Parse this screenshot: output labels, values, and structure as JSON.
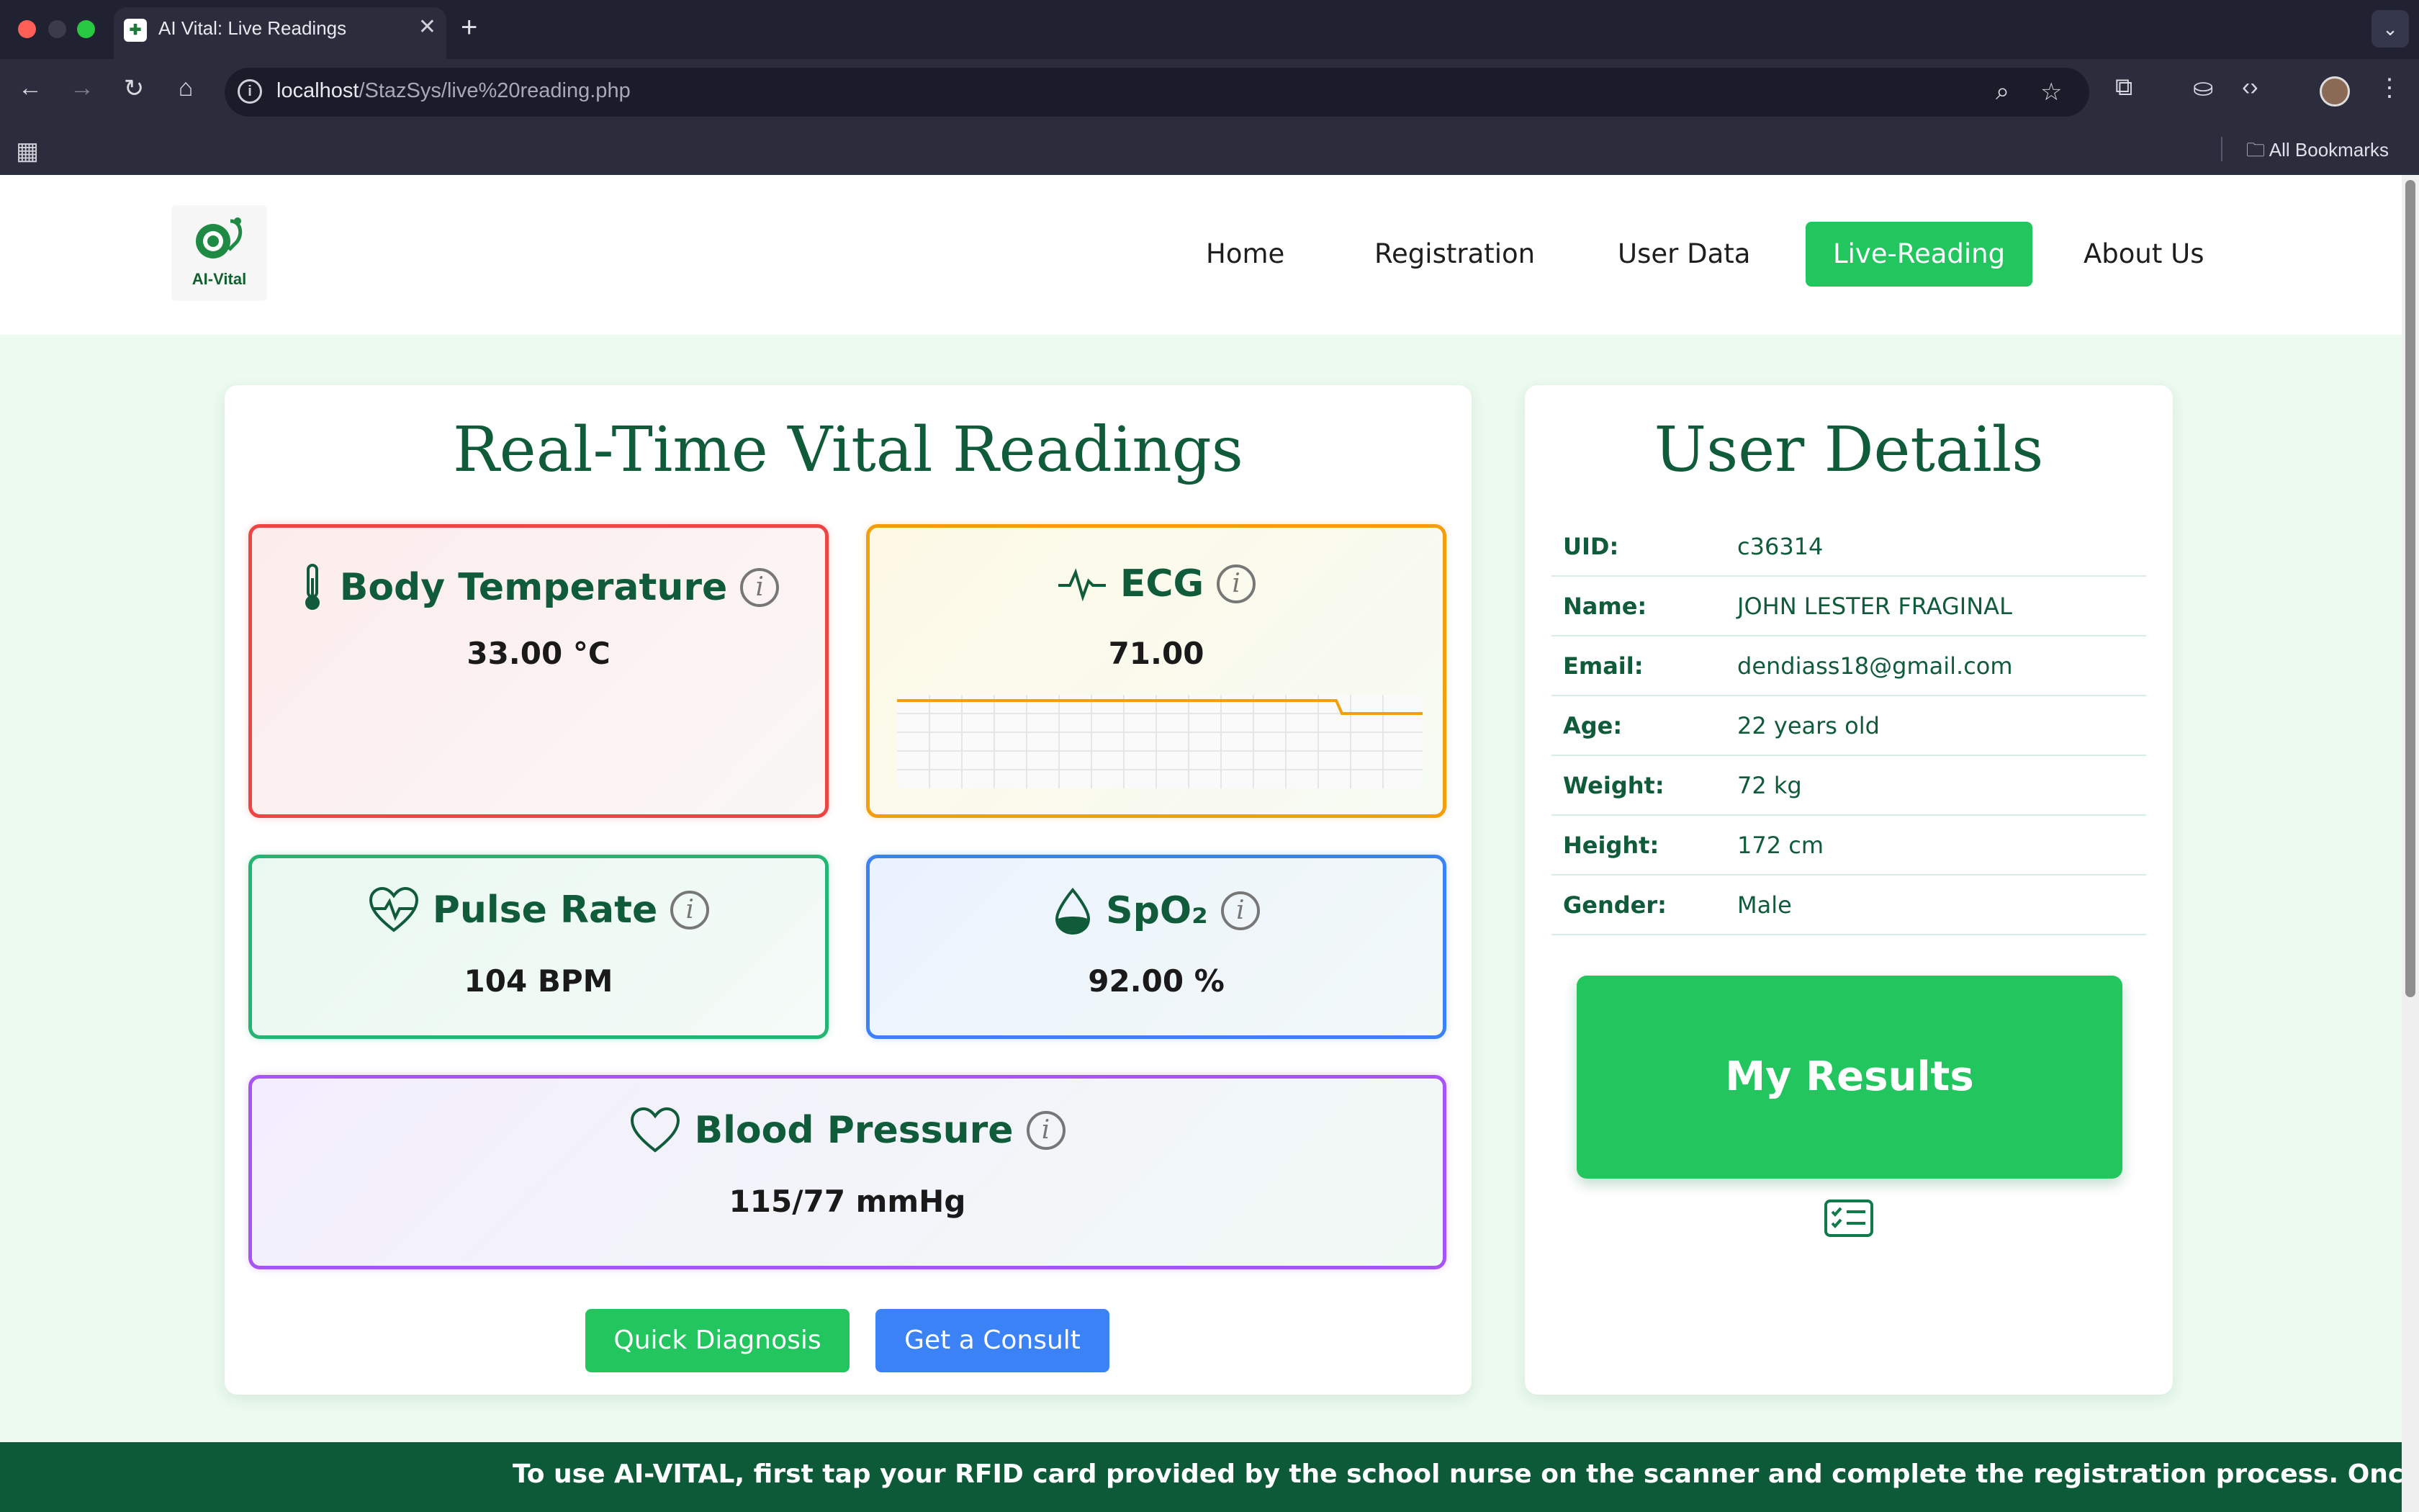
{
  "browser": {
    "tab_title": "AI Vital: Live Readings",
    "url_host": "localhost",
    "url_path": "/StazSys/live%20reading.php",
    "bookmarks_label": "All Bookmarks"
  },
  "site": {
    "logo_text": "AI-Vital",
    "nav": {
      "home": "Home",
      "registration": "Registration",
      "user_data": "User Data",
      "live_reading": "Live-Reading",
      "about": "About Us"
    },
    "active_nav": "Live-Reading",
    "accent_color": "#22c55e",
    "dark_green": "#0d5a39"
  },
  "vitals": {
    "title": "Real-Time Vital Readings",
    "info_glyph": "i",
    "temperature": {
      "label": "Body Temperature",
      "value": "33.00 °C",
      "icon": "thermometer-icon",
      "color": "#ef4444"
    },
    "ecg": {
      "label": "ECG",
      "value": "71.00",
      "icon": "ecg-wave-icon",
      "color": "#f59e0b"
    },
    "pulse": {
      "label": "Pulse Rate",
      "value": "104 BPM",
      "icon": "heart-pulse-icon",
      "color": "#22b573"
    },
    "spo2": {
      "label": "SpO₂",
      "value": "92.00 %",
      "icon": "droplet-icon",
      "color": "#3b82f6"
    },
    "bp": {
      "label": "Blood Pressure",
      "value": "115/77 mmHg",
      "icon": "heart-icon",
      "color": "#a855f7"
    },
    "buttons": {
      "quick_diagnosis": "Quick Diagnosis",
      "consult": "Get a Consult"
    }
  },
  "user": {
    "title": "User Details",
    "rows": [
      {
        "label": "UID:",
        "value": "c36314"
      },
      {
        "label": "Name:",
        "value": "JOHN LESTER FRAGINAL"
      },
      {
        "label": "Email:",
        "value": "dendiass18@gmail.com"
      },
      {
        "label": "Age:",
        "value": "22 years old"
      },
      {
        "label": "Weight:",
        "value": "72 kg"
      },
      {
        "label": "Height:",
        "value": "172 cm"
      },
      {
        "label": "Gender:",
        "value": "Male"
      }
    ],
    "results_button": "My Results"
  },
  "ticker": {
    "text": "To use AI-VITAL, first tap your RFID card provided by the school nurse on the scanner and complete the registration process. Once registered, tap your"
  }
}
